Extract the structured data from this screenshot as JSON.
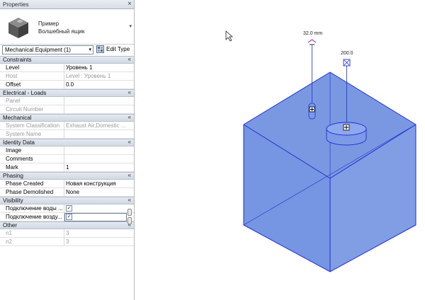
{
  "panel": {
    "title": "Properties",
    "close_glyph": "×",
    "type_name_line1": "Пример",
    "type_name_line2": "Волшебный ящик",
    "type_dropdown_glyph": "▾",
    "filter_value": "Mechanical Equipment (1)",
    "combo_glyph": "▾",
    "edit_type_label": "Edit Type",
    "collapse_glyph": "«",
    "groups": [
      {
        "name": "Constraints",
        "rows": [
          {
            "label": "Level",
            "value": "Уровень 1",
            "disabled": false
          },
          {
            "label": "Host",
            "value": "Level : Уровень 1",
            "disabled": true
          },
          {
            "label": "Offset",
            "value": "0.0",
            "disabled": false
          }
        ]
      },
      {
        "name": "Electrical - Loads",
        "rows": [
          {
            "label": "Panel",
            "value": "",
            "disabled": true
          },
          {
            "label": "Circuit Number",
            "value": "",
            "disabled": true
          }
        ]
      },
      {
        "name": "Mechanical",
        "rows": [
          {
            "label": "System Classification",
            "value": "Exhaust Air,Domestic ...",
            "disabled": true
          },
          {
            "label": "System Name",
            "value": "",
            "disabled": true
          }
        ]
      },
      {
        "name": "Identity Data",
        "rows": [
          {
            "label": "Image",
            "value": "",
            "disabled": false
          },
          {
            "label": "Comments",
            "value": "",
            "disabled": false
          },
          {
            "label": "Mark",
            "value": "1",
            "disabled": false
          }
        ]
      },
      {
        "name": "Phasing",
        "rows": [
          {
            "label": "Phase Created",
            "value": "Новая конструкция",
            "disabled": false
          },
          {
            "label": "Phase Demolished",
            "value": "None",
            "disabled": false
          }
        ]
      },
      {
        "name": "Visibility",
        "rows": [
          {
            "label": "Подключение воды ...",
            "checkbox": "✓",
            "disabled": false
          },
          {
            "label": "Подключение возду...",
            "checkbox": "✓",
            "disabled": false
          }
        ]
      },
      {
        "name": "Other",
        "rows": [
          {
            "label": "n1",
            "value": "3",
            "disabled": true
          },
          {
            "label": "n2",
            "value": "3",
            "disabled": true
          }
        ]
      }
    ]
  },
  "viewport": {
    "dim_water": "32.0 mm",
    "dim_air": "200.0",
    "box_color": "#6f8fe0",
    "edge_color": "#1f2fd0"
  }
}
